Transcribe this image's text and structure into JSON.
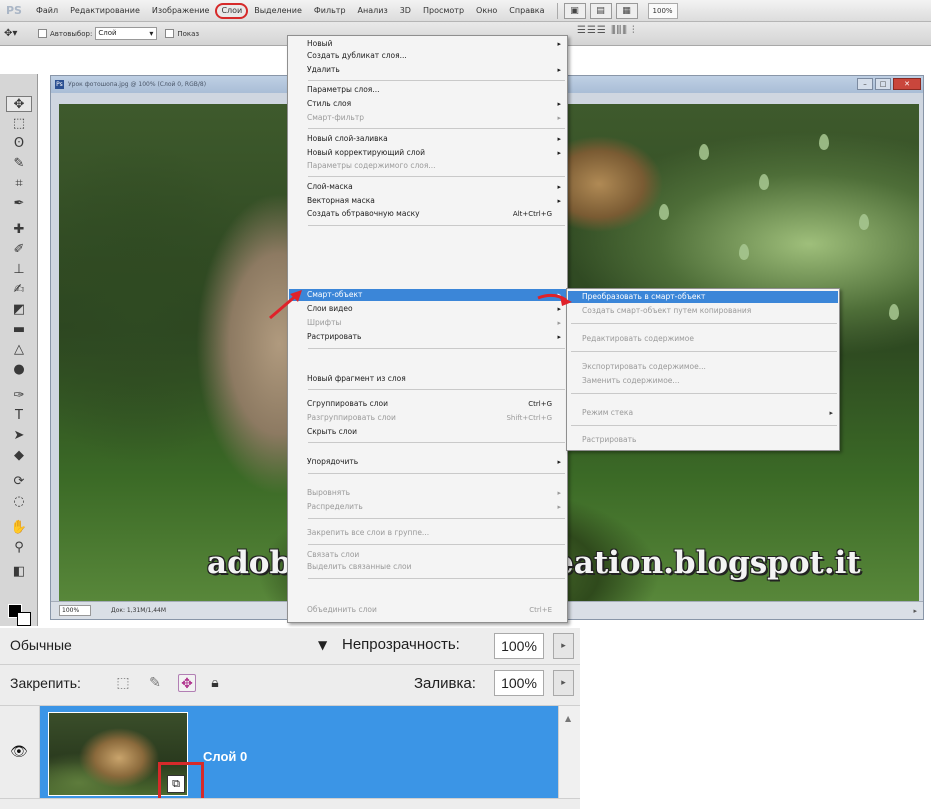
{
  "menubar": {
    "logo": "PS",
    "items": [
      "Файл",
      "Редактирование",
      "Изображение",
      "Слои",
      "Выделение",
      "Фильтр",
      "Анализ",
      "3D",
      "Просмотр",
      "Окно",
      "Справка"
    ],
    "active_index": 3,
    "zoom": "100%"
  },
  "options": {
    "autoselect_label": "Автовыбор:",
    "autoselect_value": "Слой",
    "show_label": "Показ"
  },
  "document": {
    "title": "Урок фотошопа.jpg @ 100% (Слой 0, RGB/8)",
    "status_zoom": "100%",
    "status_doc": "Док: 1,31M/1,44M",
    "watermark": "adobe-photoshop-creation.blogspot.it"
  },
  "layer_menu": {
    "items": [
      {
        "label": "Новый",
        "submenu": true
      },
      {
        "label": "Создать дубликат слоя..."
      },
      {
        "label": "Удалить",
        "submenu": true
      },
      {
        "label": "Параметры слоя..."
      },
      {
        "label": "Стиль слоя",
        "submenu": true
      },
      {
        "label": "Смарт-фильтр",
        "submenu": true,
        "disabled": true
      },
      {
        "label": "Новый слой-заливка",
        "submenu": true
      },
      {
        "label": "Новый корректирующий слой",
        "submenu": true
      },
      {
        "label": "Параметры содержимого слоя...",
        "disabled": true
      },
      {
        "label": "Слой-маска",
        "submenu": true
      },
      {
        "label": "Векторная маска",
        "submenu": true
      },
      {
        "label": "Создать обтравочную маску",
        "shortcut": "Alt+Ctrl+G"
      },
      {
        "label": "Смарт-объект",
        "submenu": true,
        "highlighted": true
      },
      {
        "label": "Слои видео",
        "submenu": true
      },
      {
        "label": "Шрифты",
        "submenu": true,
        "disabled": true
      },
      {
        "label": "Растрировать",
        "submenu": true
      },
      {
        "label": "Новый фрагмент из слоя"
      },
      {
        "label": "Сгруппировать слои",
        "shortcut": "Ctrl+G"
      },
      {
        "label": "Разгруппировать слои",
        "shortcut": "Shift+Ctrl+G",
        "disabled": true
      },
      {
        "label": "Скрыть слои"
      },
      {
        "label": "Упорядочить",
        "submenu": true
      },
      {
        "label": "Выровнять",
        "submenu": true,
        "disabled": true
      },
      {
        "label": "Распределить",
        "submenu": true,
        "disabled": true
      },
      {
        "label": "Закрепить все слои в группе...",
        "disabled": true
      },
      {
        "label": "Связать слои",
        "disabled": true
      },
      {
        "label": "Выделить связанные слои",
        "disabled": true
      },
      {
        "label": "Объединить слои",
        "shortcut": "Ctrl+E",
        "disabled": true
      }
    ]
  },
  "smart_submenu": {
    "items": [
      {
        "label": "Преобразовать в смарт-объект",
        "highlighted": true
      },
      {
        "label": "Создать смарт-объект путем копирования",
        "disabled": true
      },
      {
        "label": "Редактировать содержимое",
        "disabled": true
      },
      {
        "label": "Экспортировать содержимое...",
        "disabled": true
      },
      {
        "label": "Заменить содержимое...",
        "disabled": true
      },
      {
        "label": "Режим стека",
        "submenu": true,
        "disabled": true
      },
      {
        "label": "Растрировать",
        "disabled": true
      }
    ]
  },
  "layers_panel": {
    "blend_mode": "Обычные",
    "opacity_label": "Непрозрачность:",
    "opacity_value": "100%",
    "lock_label": "Закрепить:",
    "fill_label": "Заливка:",
    "fill_value": "100%",
    "layer_name": "Слой 0"
  },
  "colors": {
    "highlight": "#3b86d8",
    "layer_selected": "#3b95e6",
    "callout_red": "#d62a2a"
  }
}
